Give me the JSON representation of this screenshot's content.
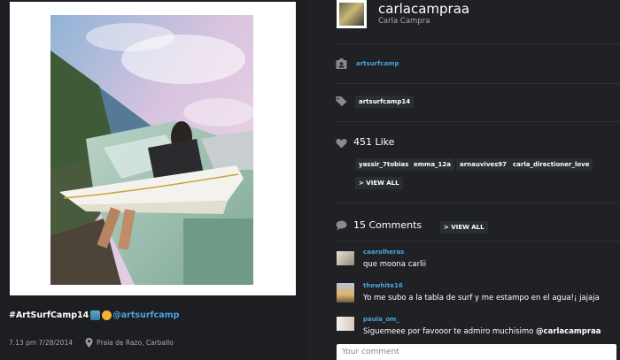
{
  "post": {
    "caption_hashtag": "#ArtSurfCamp14",
    "caption_mention": "@artsurfcamp",
    "time": "7.13 pm 7/28/2014",
    "location": "Praia de Razo, Carballo"
  },
  "profile": {
    "username": "carlacampraa",
    "full_name": "Carla Campra"
  },
  "account": {
    "label": "artsurfcamp"
  },
  "tags": [
    "artsurfcamp14"
  ],
  "likes": {
    "label": "451 Like",
    "users": [
      "yassir_7tobias",
      "emma_12a",
      "arnauvives97",
      "carla_directioner_love"
    ],
    "view_all": "> VIEW ALL"
  },
  "comments": {
    "label": "15 Comments",
    "view_all": "> VIEW ALL",
    "items": [
      {
        "user": "caarolheras",
        "text": "que moona carlii"
      },
      {
        "user": "thewhite16",
        "text": "Yo me subo a la tabla de surf y me estampo en el agua!¡ jajaja"
      },
      {
        "user": "paula_om_",
        "text_prefix": "Siguemeee por favooor te admiro muchisimo ",
        "text_mention": "@carlacampraa"
      }
    ],
    "input_placeholder": "Your comment"
  },
  "icons": {
    "account": "id-badge-icon",
    "tag": "tag-icon",
    "likes": "heart-icon",
    "comments": "speech-bubble-icon",
    "location": "map-pin-icon"
  },
  "colors": {
    "background": "#1c1e21",
    "link": "#4aa3df",
    "tag_bg": "#2a2d31"
  }
}
